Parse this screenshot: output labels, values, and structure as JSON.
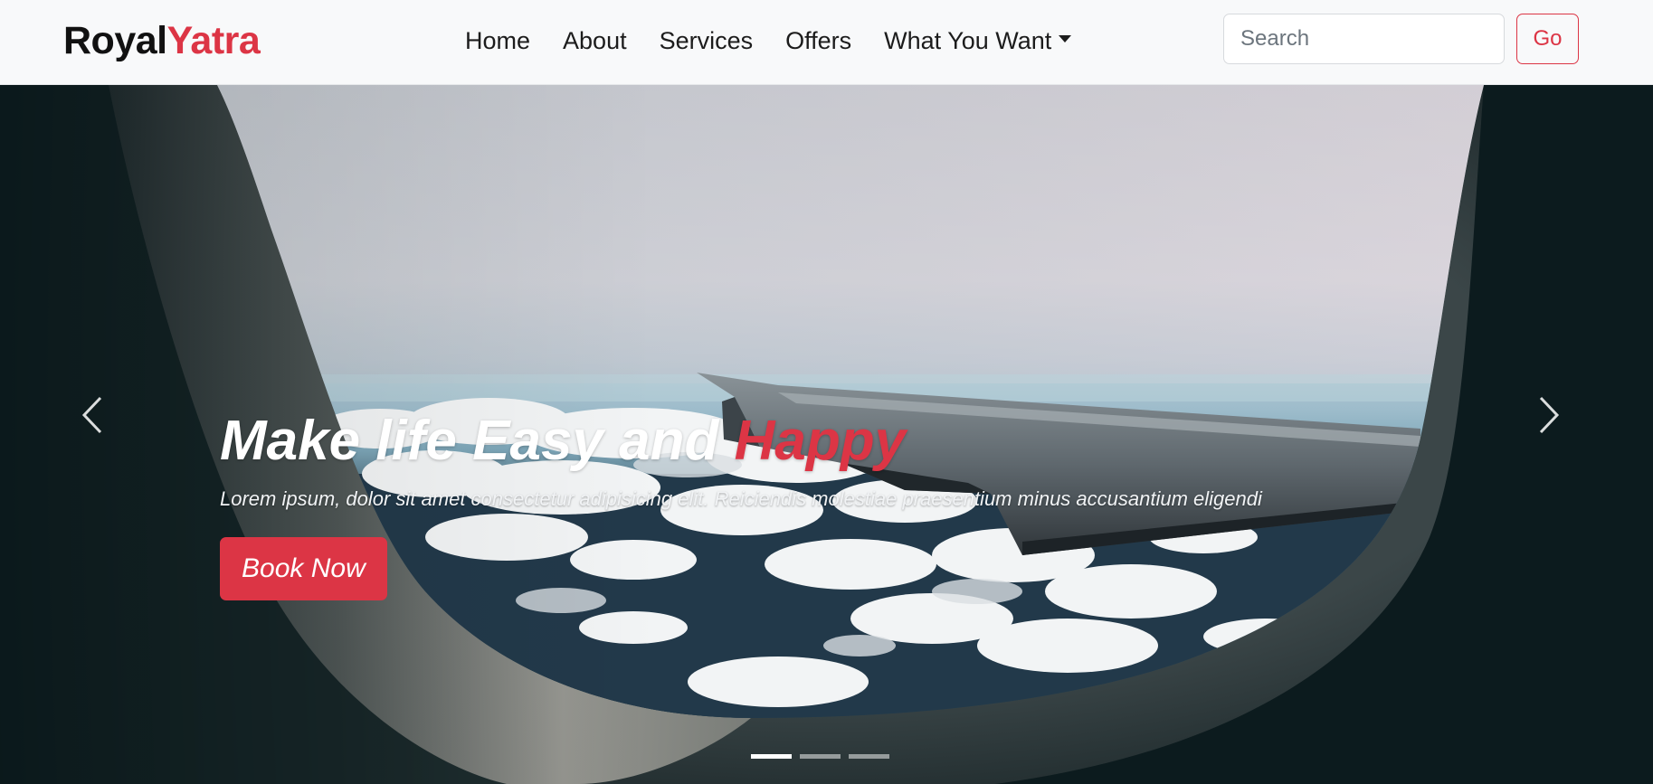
{
  "brand": {
    "part1": "Royal",
    "part2": "Yatra"
  },
  "nav": {
    "items": [
      {
        "label": "Home"
      },
      {
        "label": "About"
      },
      {
        "label": "Services"
      },
      {
        "label": "Offers"
      }
    ],
    "dropdown": {
      "label": "What You Want",
      "icon": "caret-down-icon"
    }
  },
  "search": {
    "placeholder": "Search",
    "value": "",
    "button_label": "Go"
  },
  "hero": {
    "title_main": "Make life Easy and ",
    "title_accent": "Happy",
    "subtitle": "Lorem ipsum, dolor sit amet consectetur adipisicing elit. Reiciendis molestiae praesentium minus accusantium eligendi",
    "cta_label": "Book Now",
    "prev_icon": "chevron-left-icon",
    "next_icon": "chevron-right-icon",
    "slides_count": 3,
    "active_slide": 1
  },
  "colors": {
    "accent": "#dc3545",
    "navbar_bg": "#f8f9fa",
    "text_dark": "#111111"
  }
}
